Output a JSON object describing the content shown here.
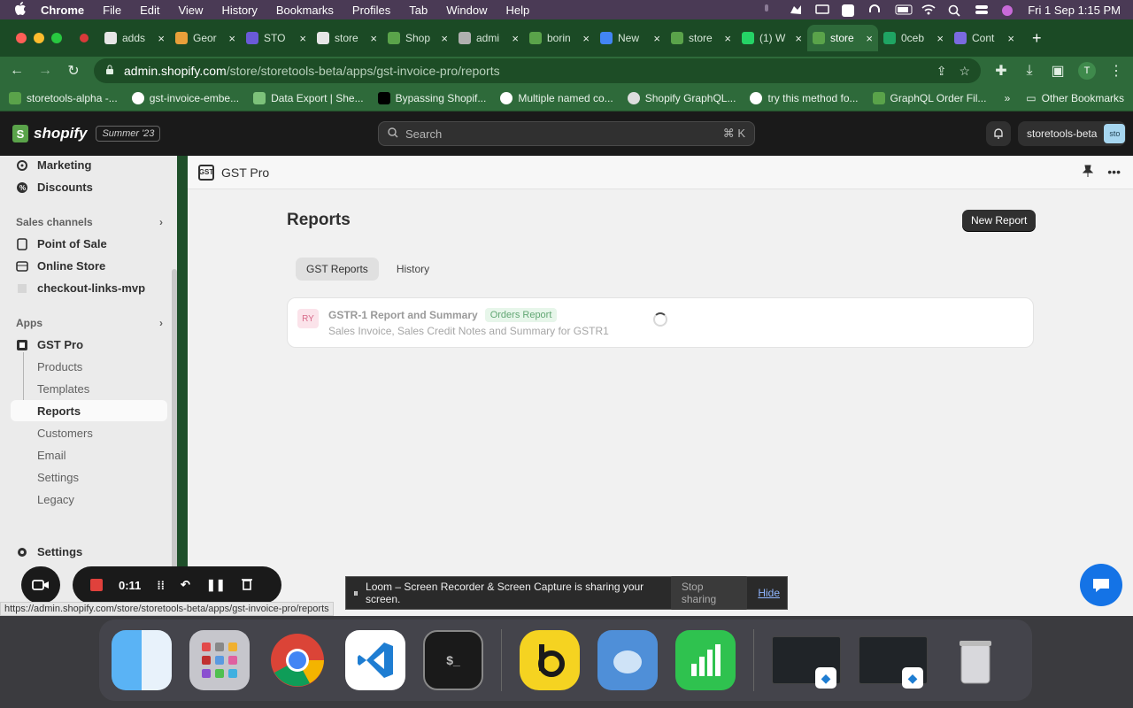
{
  "menubar": {
    "app": "Chrome",
    "items": [
      "File",
      "Edit",
      "View",
      "History",
      "Bookmarks",
      "Profiles",
      "Tab",
      "Window",
      "Help"
    ],
    "clock": "Fri 1 Sep  1:15 PM"
  },
  "tabs": [
    {
      "label": "adds",
      "color": "#e6e6e6"
    },
    {
      "label": "Geor",
      "color": "#e8a03a"
    },
    {
      "label": "STO",
      "color": "#6a5ad8"
    },
    {
      "label": "store",
      "color": "#e6e6e6"
    },
    {
      "label": "Shop",
      "color": "#5aa34a"
    },
    {
      "label": "admi",
      "color": "#b0b0b0"
    },
    {
      "label": "borin",
      "color": "#5aa34a"
    },
    {
      "label": "New",
      "color": "#4285f4"
    },
    {
      "label": "store",
      "color": "#5aa34a"
    },
    {
      "label": "(1) W",
      "color": "#25d366"
    },
    {
      "label": "store",
      "color": "#5aa34a"
    },
    {
      "label": "0ceb",
      "color": "#1fa463"
    },
    {
      "label": "Cont",
      "color": "#7a6ae0"
    }
  ],
  "active_tab_index": 10,
  "address": {
    "host": "admin.shopify.com",
    "path": "/store/storetools-beta/apps/gst-invoice-pro/reports"
  },
  "profile_initial": "T",
  "bookmarks": [
    "storetools-alpha -...",
    "gst-invoice-embe...",
    "Data Export | She...",
    "Bypassing Shopif...",
    "Multiple named co...",
    "Shopify GraphQL...",
    "try this method fo...",
    "GraphQL Order Fil..."
  ],
  "bookmarks_more": "»",
  "bookmarks_other": "Other Bookmarks",
  "shopify": {
    "logo": "shopify",
    "edition": "Summer '23",
    "search_placeholder": "Search",
    "search_shortcut": "⌘ K",
    "store_name": "storetools-beta",
    "store_avatar": "sto"
  },
  "sidebar": {
    "top_items": [
      "Marketing",
      "Discounts"
    ],
    "sales_channels_title": "Sales channels",
    "sales_channels": [
      "Point of Sale",
      "Online Store",
      "checkout-links-mvp"
    ],
    "apps_title": "Apps",
    "app_name": "GST Pro",
    "app_items": [
      "Products",
      "Templates",
      "Reports",
      "Customers",
      "Email",
      "Settings",
      "Legacy"
    ],
    "settings": "Settings"
  },
  "main": {
    "app_title": "GST Pro",
    "app_icon": "GST",
    "page_title": "Reports",
    "new_report": "New Report",
    "tabs": [
      "GST Reports",
      "History"
    ],
    "card": {
      "avatar": "RY",
      "title": "GSTR-1 Report and Summary",
      "badge": "Orders Report",
      "subtitle": "Sales Invoice, Sales Credit Notes and Summary for GSTR1"
    }
  },
  "loom": {
    "timer": "0:11",
    "share_message": "Loom – Screen Recorder & Screen Capture is sharing your screen.",
    "stop_sharing": "Stop sharing",
    "hide": "Hide"
  },
  "status_url": "https://admin.shopify.com/store/storetools-beta/apps/gst-invoice-pro/reports",
  "dock_apps": [
    "finder",
    "launchpad",
    "chrome",
    "vscode",
    "terminal",
    "beekeeper",
    "tableplus",
    "numbers"
  ]
}
